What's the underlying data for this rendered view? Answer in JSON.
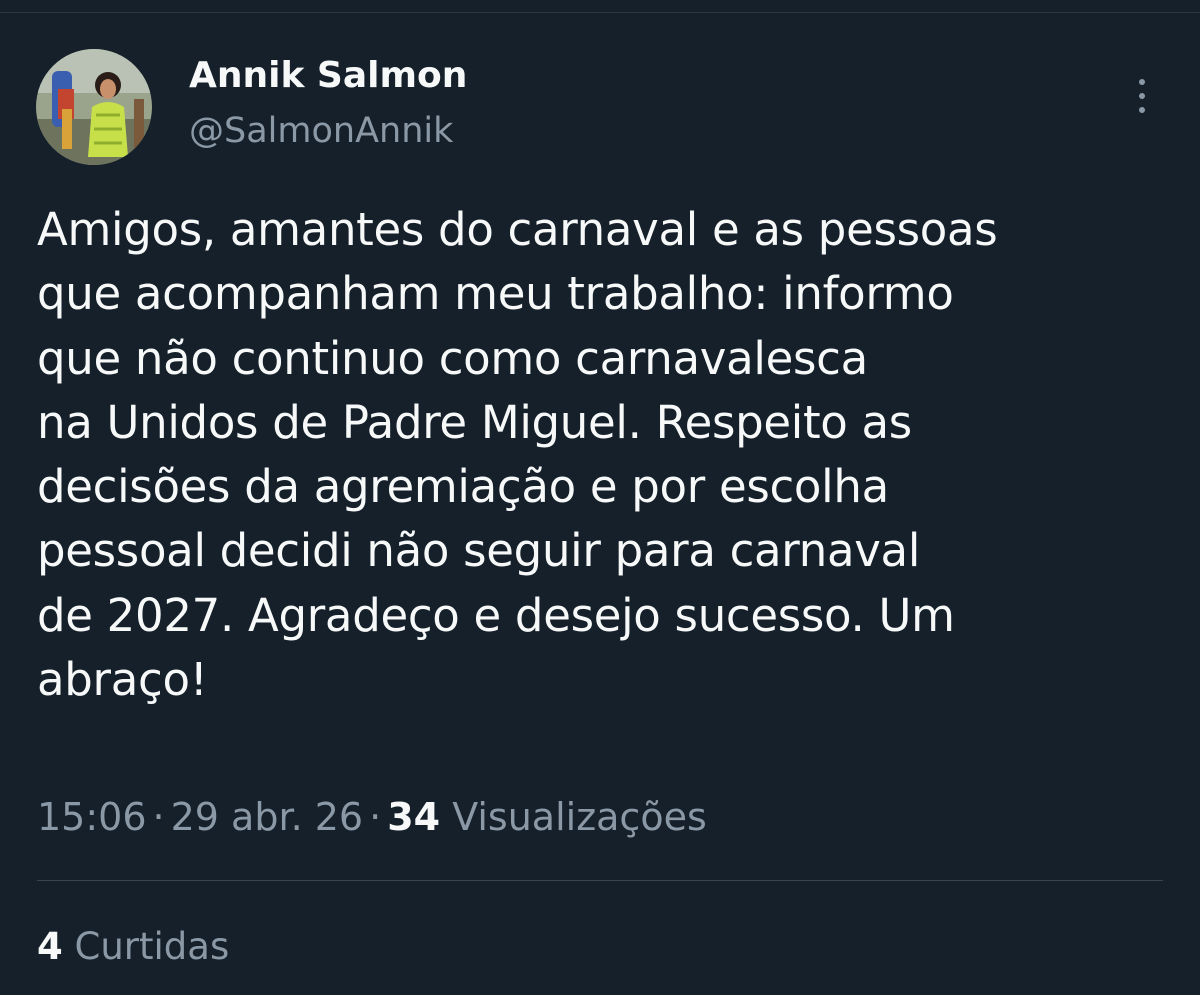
{
  "tweet": {
    "author": {
      "display_name": "Annik Salmon",
      "handle": "@SalmonAnnik",
      "avatar_icon": "profile-photo"
    },
    "more_icon": "more-vertical-icon",
    "text_lines": [
      "Amigos, amantes do carnaval e as pessoas",
      "que acompanham meu trabalho: informo",
      "que não continuo como carnavalesca",
      "na Unidos de Padre Miguel. Respeito as",
      "decisões da agremiação e por escolha",
      "pessoal decidi não seguir para carnaval",
      "de 2027. Agradeço e desejo sucesso. Um",
      "abraço!"
    ],
    "meta": {
      "time": "15:06",
      "separator": "·",
      "date": "29 abr. 26",
      "views_count": "34",
      "views_label": "Visualizações"
    },
    "likes": {
      "count": "4",
      "label": "Curtidas"
    }
  },
  "colors": {
    "background": "#15202b",
    "primary_text": "#f7f9f9",
    "secondary_text": "#8b98a5",
    "divider": "#38444d"
  }
}
